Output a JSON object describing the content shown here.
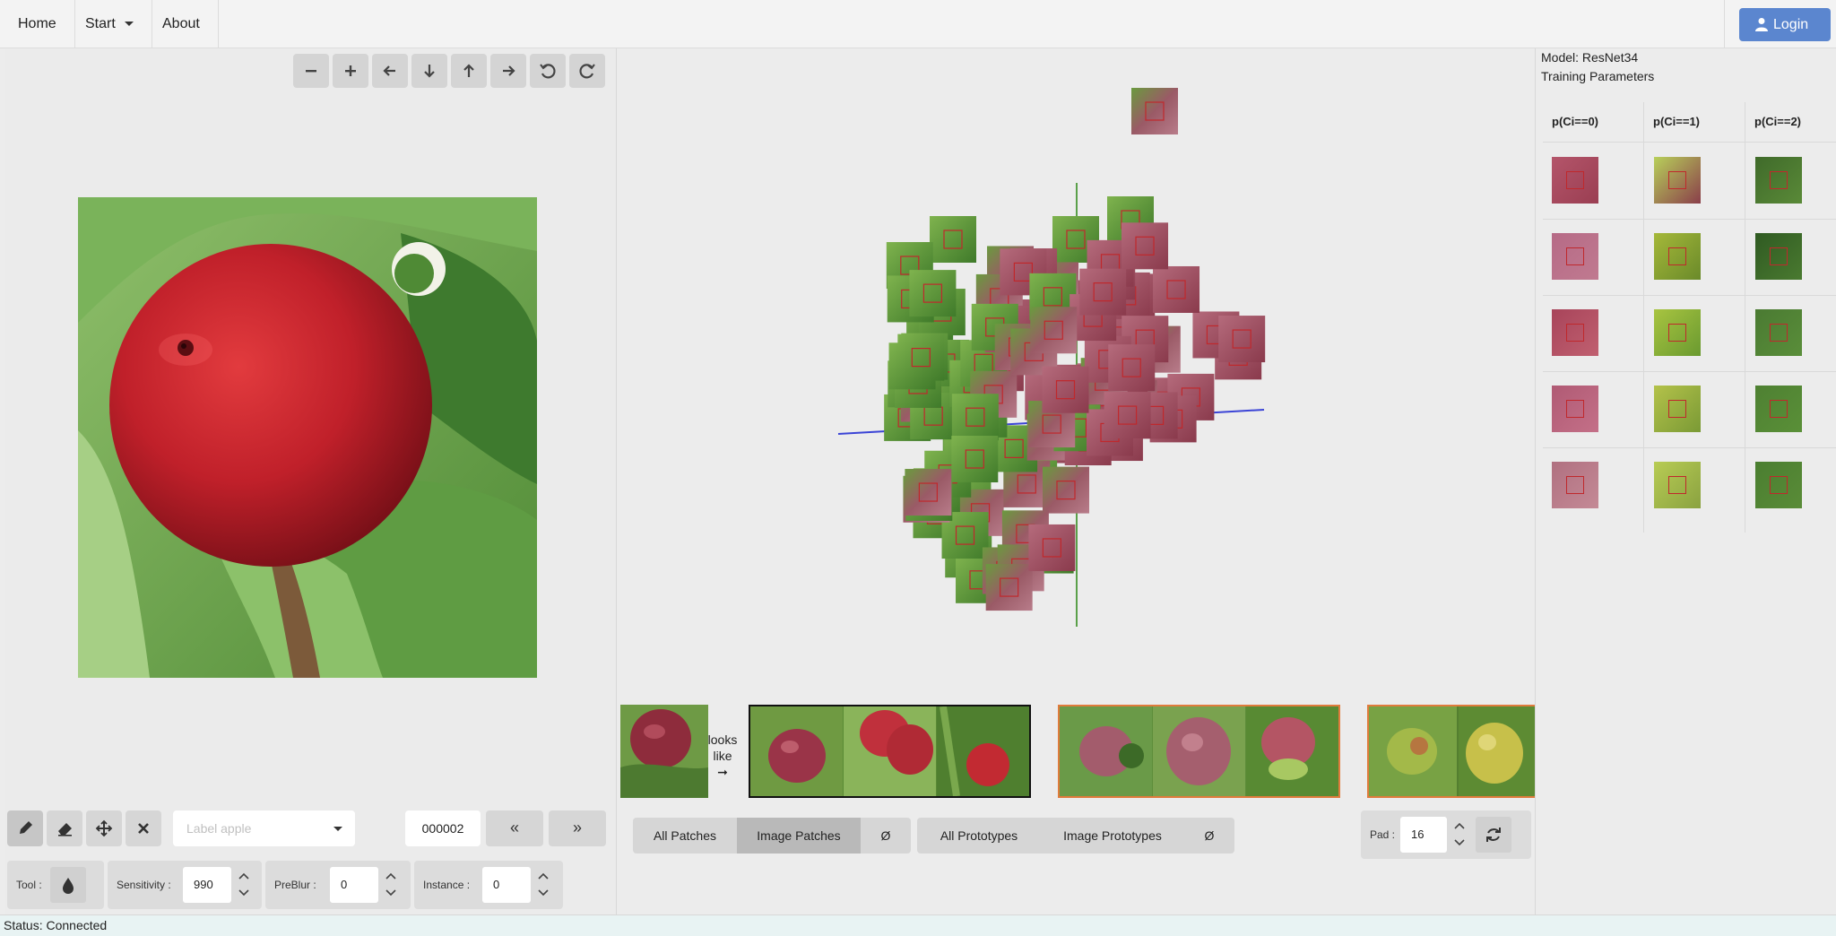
{
  "nav": {
    "home": "Home",
    "start": "Start",
    "about": "About",
    "login": "Login"
  },
  "toolbar": {
    "zoom_out_icon": "minus-icon",
    "zoom_in_icon": "plus-icon",
    "left_icon": "arrow-left-icon",
    "down_icon": "arrow-down-icon",
    "up_icon": "arrow-up-icon",
    "right_icon": "arrow-right-icon",
    "undo_icon": "rotate-ccw-icon",
    "redo_icon": "rotate-cw-icon"
  },
  "editor": {
    "label_placeholder": "Label apple",
    "frame": "000002",
    "prev": "«",
    "next": "»",
    "tool_label": "Tool :",
    "sensitivity_label": "Sensitivity :",
    "sensitivity_value": "990",
    "preblur_label": "PreBlur :",
    "preblur_value": "0",
    "instance_label": "Instance :",
    "instance_value": "0"
  },
  "strip": {
    "looks_like": [
      "looks",
      "like",
      "➞"
    ]
  },
  "tabs": {
    "patches": [
      {
        "label": "All Patches",
        "active": false
      },
      {
        "label": "Image Patches",
        "active": true
      },
      {
        "label": "Ø",
        "active": false
      }
    ],
    "prototypes": [
      {
        "label": "All Prototypes",
        "active": false
      },
      {
        "label": "Image Prototypes",
        "active": false
      },
      {
        "label": "Ø",
        "active": false
      }
    ],
    "pad_label": "Pad :",
    "pad_value": "16"
  },
  "right": {
    "model": "Model: ResNet34",
    "training": "Training Parameters",
    "columns": [
      "p(Ci==0)",
      "p(Ci==1)",
      "p(Ci==2)"
    ]
  },
  "status": "Status: Connected",
  "colors": {
    "accent": "#5b86cf",
    "apple_red": "#b3212b",
    "leaf_green": "#5c9a3c",
    "strip_orange": "#e07b3c"
  }
}
